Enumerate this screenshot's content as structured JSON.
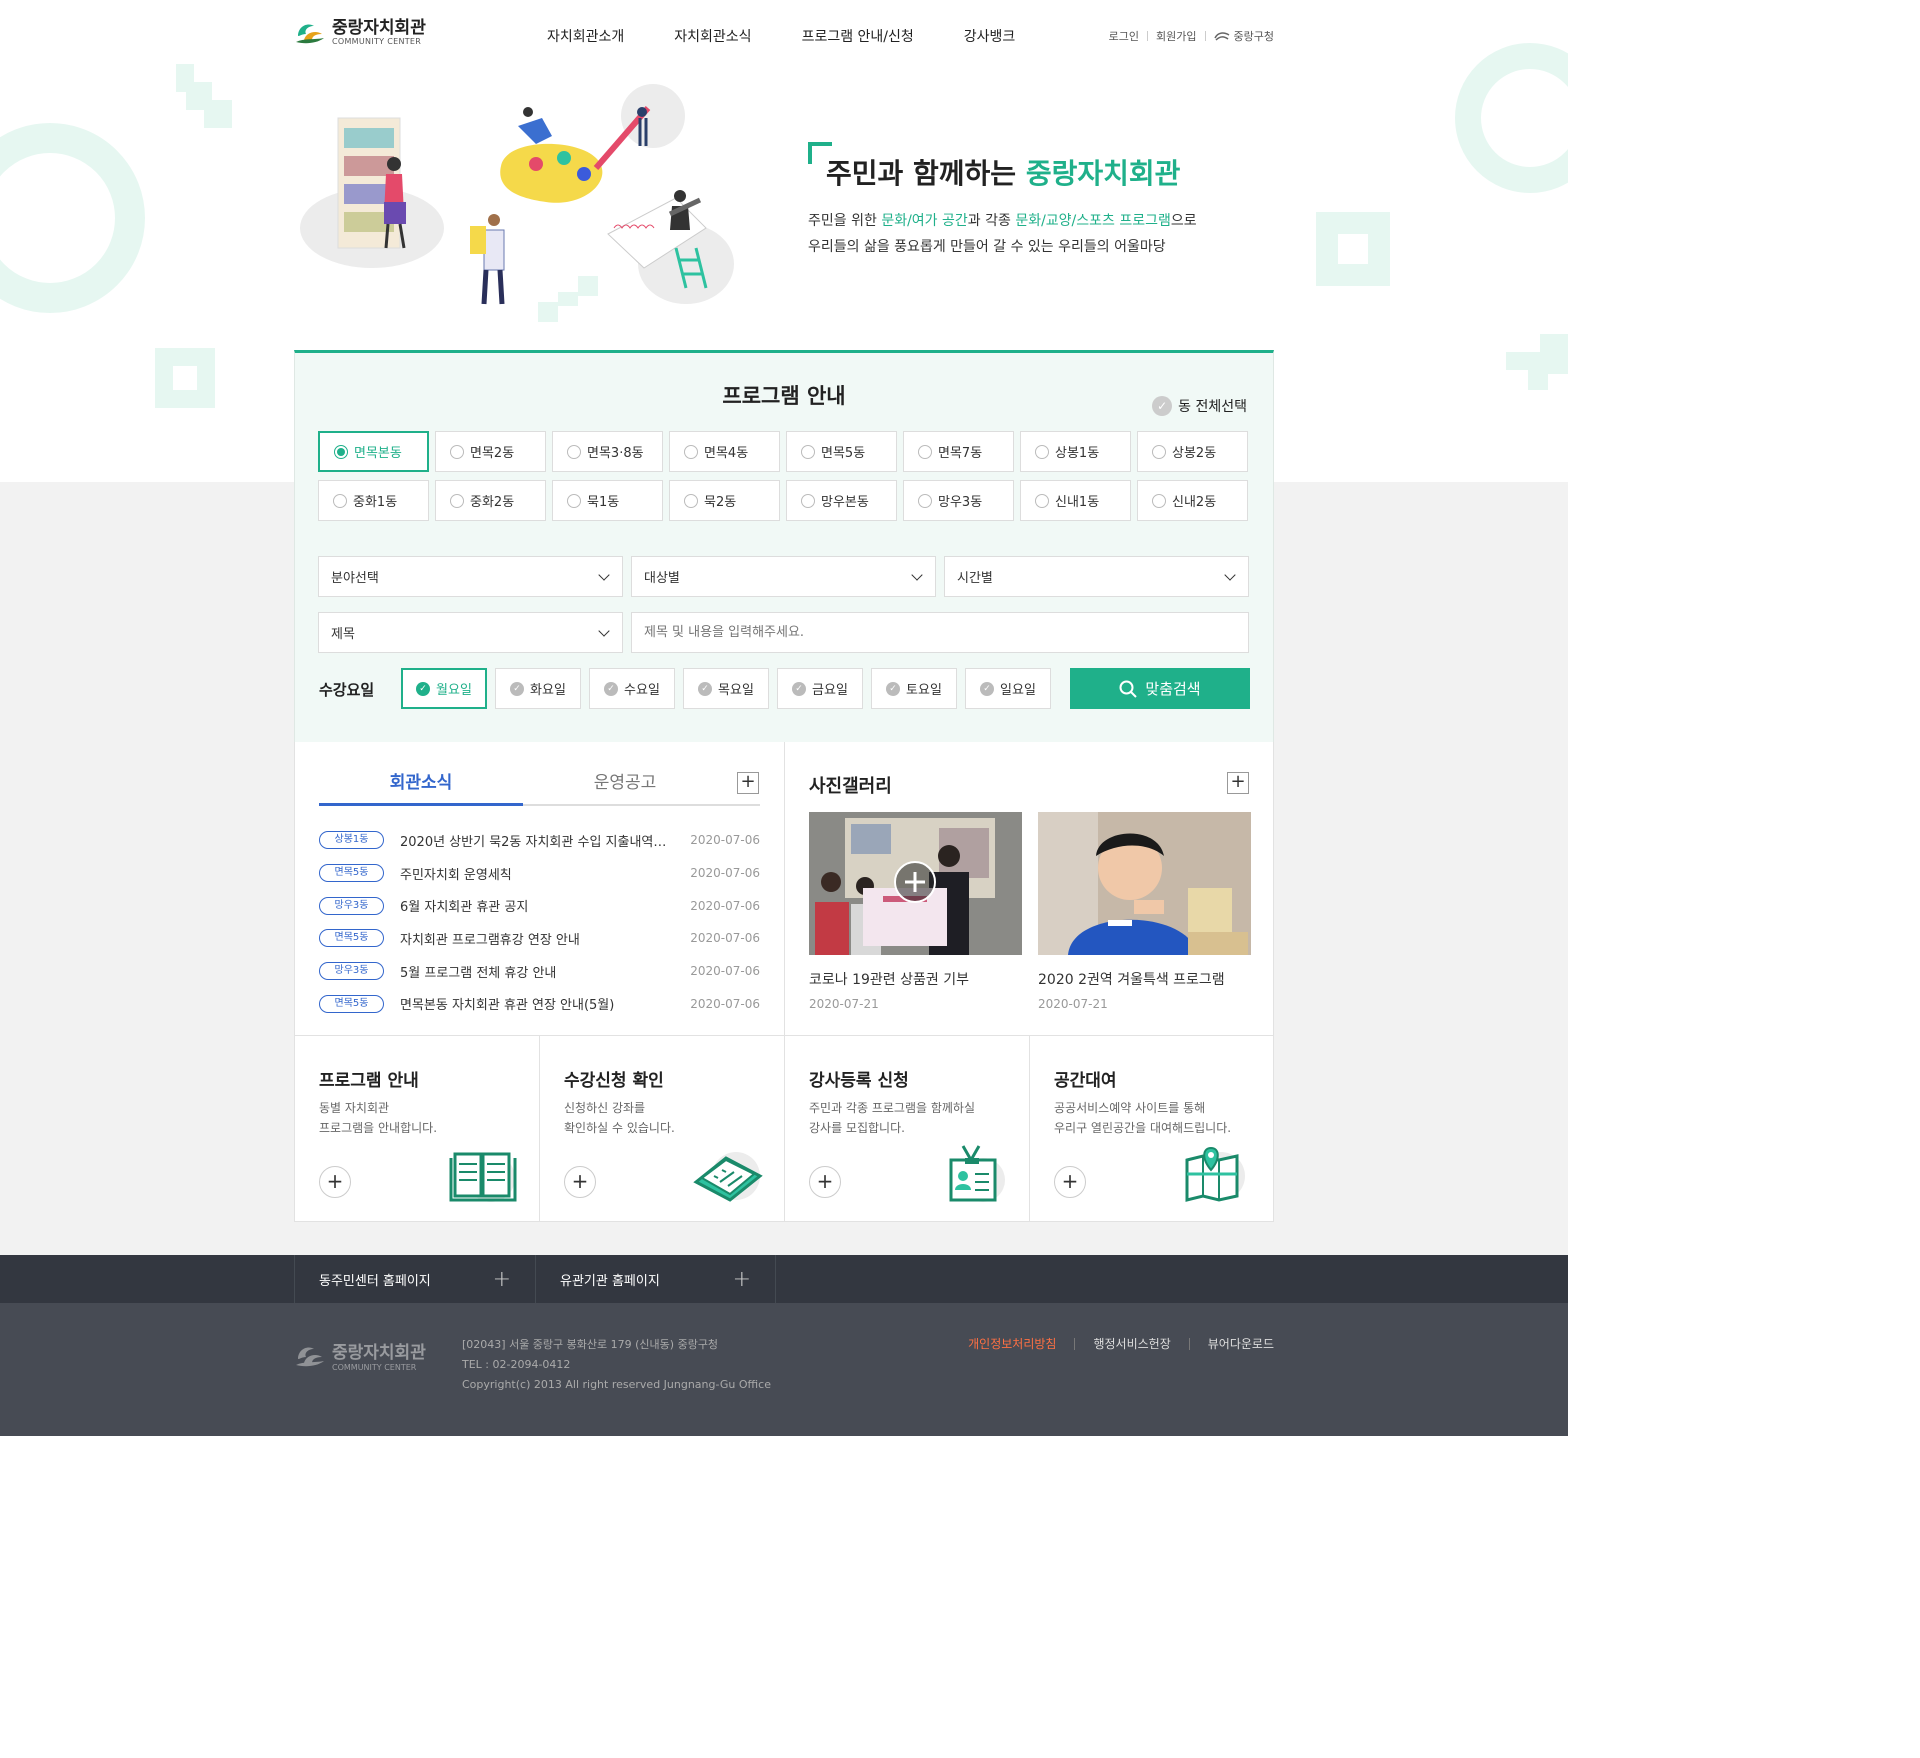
{
  "header": {
    "logo_ko": "중랑자치회관",
    "logo_en": "COMMUNITY CENTER",
    "nav": [
      "자치회관소개",
      "자치회관소식",
      "프로그램 안내/신청",
      "강사뱅크"
    ],
    "util": {
      "login": "로그인",
      "join": "회원가입",
      "gu": "중랑구청"
    }
  },
  "hero": {
    "title_prefix": "주민과 함께하는 ",
    "title_accent": "중랑자치회관",
    "desc1_a": "주민을 위한 ",
    "desc1_b": "문화/여가 공간",
    "desc1_c": "과 각종 ",
    "desc1_d": "문화/교양/스포츠 프로그램",
    "desc1_e": "으로",
    "desc2": "우리들의 삶을 풍요롭게 만들어 갈 수 있는 우리들의 어울마당"
  },
  "search": {
    "title": "프로그램 안내",
    "all_select": "동 전체선택",
    "dongs": [
      "면목본동",
      "면목2동",
      "면목3·8동",
      "면목4동",
      "면목5동",
      "면목7동",
      "상봉1동",
      "상봉2동",
      "중화1동",
      "중화2동",
      "묵1동",
      "묵2동",
      "망우본동",
      "망우3동",
      "신내1동",
      "신내2동"
    ],
    "selected_dong": "면목본동",
    "field": "분야선택",
    "target": "대상별",
    "time": "시간별",
    "type": "제목",
    "keyword_placeholder": "제목 및 내용을 입력해주세요.",
    "days_label": "수강요일",
    "days": [
      "월요일",
      "화요일",
      "수요일",
      "목요일",
      "금요일",
      "토요일",
      "일요일"
    ],
    "selected_day": "월요일",
    "button": "맞춤검색"
  },
  "news": {
    "tabs": [
      "회관소식",
      "운영공고"
    ],
    "active_tab": "회관소식",
    "items": [
      {
        "badge": "상봉1동",
        "title": "2020년 상반기 묵2동 자치회관 수입 지출내역 공...",
        "date": "2020-07-06"
      },
      {
        "badge": "면목5동",
        "title": "주민자치회 운영세칙",
        "date": "2020-07-06"
      },
      {
        "badge": "망우3동",
        "title": "6월 자치회관 휴관 공지",
        "date": "2020-07-06"
      },
      {
        "badge": "면목5동",
        "title": "자치회관 프로그램휴강 연장 안내",
        "date": "2020-07-06"
      },
      {
        "badge": "망우3동",
        "title": "5월 프로그램 전체 휴강 안내",
        "date": "2020-07-06"
      },
      {
        "badge": "면목5동",
        "title": "면목본동 자치회관 휴관 연장 안내(5월)",
        "date": "2020-07-06"
      }
    ]
  },
  "gallery": {
    "title": "사진갤러리",
    "items": [
      {
        "caption": "코로나 19관련 상품권 기부",
        "date": "2020-07-21"
      },
      {
        "caption": "2020 2권역 겨울특색 프로그램",
        "date": "2020-07-21"
      }
    ]
  },
  "quick": [
    {
      "title": "프로그램 안내",
      "desc": "동별 자치회관\n프로그램을 안내합니다.",
      "icon": "book-icon"
    },
    {
      "title": "수강신청 확인",
      "desc": "신청하신 강좌를\n확인하실 수 있습니다.",
      "icon": "checklist-icon"
    },
    {
      "title": "강사등록 신청",
      "desc": "주민과 각종 프로그램을 함께하실\n강사를 모집합니다.",
      "icon": "id-card-icon"
    },
    {
      "title": "공간대여",
      "desc": "공공서비스예약 사이트를 통해\n우리구 열린공간을 대여해드립니다.",
      "icon": "map-icon"
    }
  ],
  "footer": {
    "links": [
      "동주민센터 홈페이지",
      "유관기관 홈페이지"
    ],
    "logo_ko": "중랑자치회관",
    "logo_en": "COMMUNITY CENTER",
    "address": "[02043] 서울 중랑구 봉화산로 179 (신내동) 중랑구청",
    "tel": "TEL : 02-2094-0412",
    "copyright": "Copyright(c) 2013 All right reserved Jungnang-Gu Office",
    "nav": [
      "개인정보처리방침",
      "행정서비스헌장",
      "뷰어다운로드"
    ]
  },
  "colors": {
    "accent": "#1fb08a",
    "news_blue": "#3366cc",
    "footer_dark": "#333740",
    "footer": "#474b54",
    "privacy": "#ff7043"
  }
}
